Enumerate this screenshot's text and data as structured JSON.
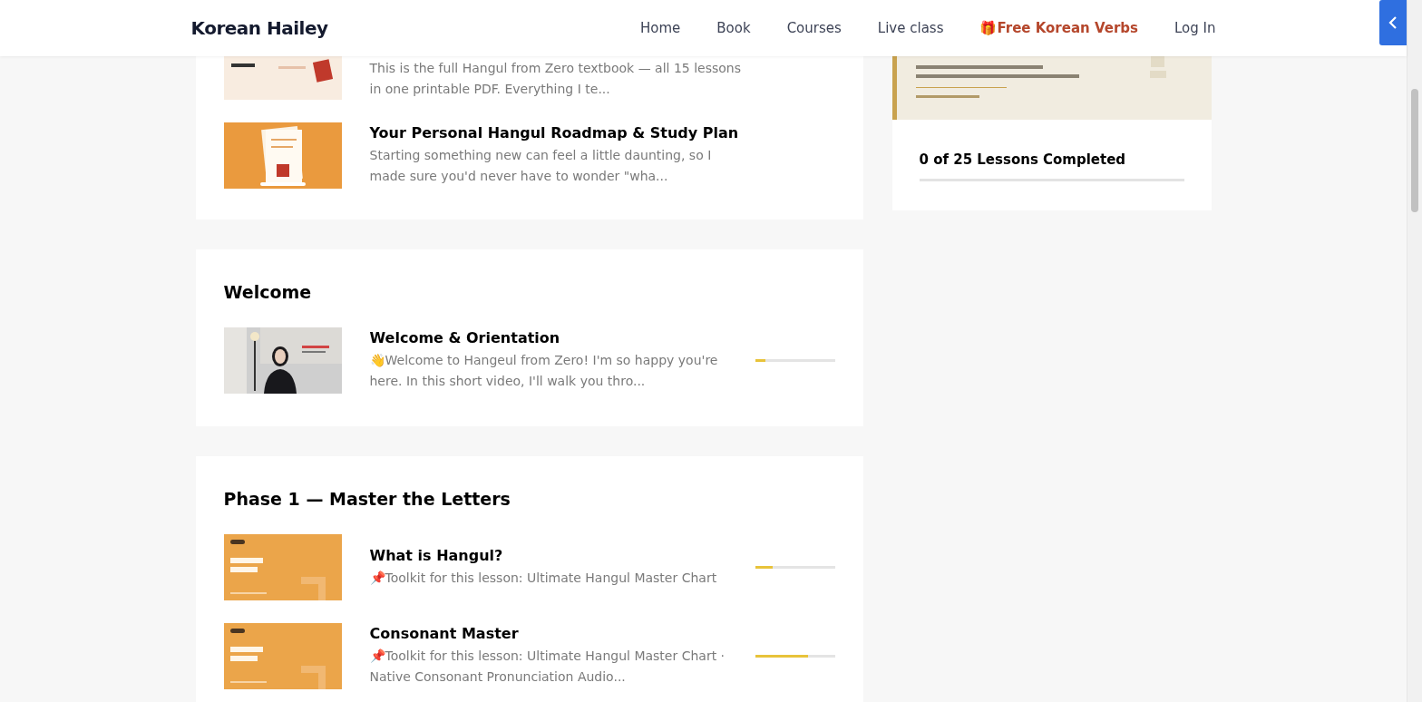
{
  "header": {
    "logo": "Korean Hailey",
    "nav": [
      {
        "label": "Home",
        "kind": "plain"
      },
      {
        "label": "Book",
        "kind": "plain"
      },
      {
        "label": "Courses",
        "kind": "plain"
      },
      {
        "label": "Live class",
        "kind": "plain"
      },
      {
        "label": "🎁Free Korean Verbs",
        "kind": "highlight"
      },
      {
        "label": "Log In",
        "kind": "plain"
      }
    ]
  },
  "sections": [
    {
      "lessons": [
        {
          "description": "This is the full Hangul from Zero textbook — all 15 lessons in one printable PDF. Everything I te..."
        },
        {
          "title": "Your Personal Hangul Roadmap & Study Plan",
          "description": "Starting something new can feel a little daunting, so I made sure you'd never have to wonder \"wha..."
        }
      ]
    },
    {
      "title": "Welcome",
      "lessons": [
        {
          "title": "Welcome & Orientation",
          "description": "👋Welcome to Hangeul from Zero! I'm so happy you're here. In this short video, I'll walk you thro...",
          "level": 0.13
        }
      ]
    },
    {
      "title": "Phase 1 — Master the Letters",
      "lessons": [
        {
          "title": "What is Hangul?",
          "description": "📌Toolkit for this lesson: Ultimate Hangul Master Chart",
          "level": 0.22
        },
        {
          "title": "Consonant Master",
          "description": "📌Toolkit for this lesson: Ultimate Hangul Master Chart · Native Consonant Pronunciation Audio...",
          "level": 0.67
        }
      ]
    }
  ],
  "sidebar": {
    "progress_text": "0 of 25 Lessons Completed",
    "level": 0
  }
}
